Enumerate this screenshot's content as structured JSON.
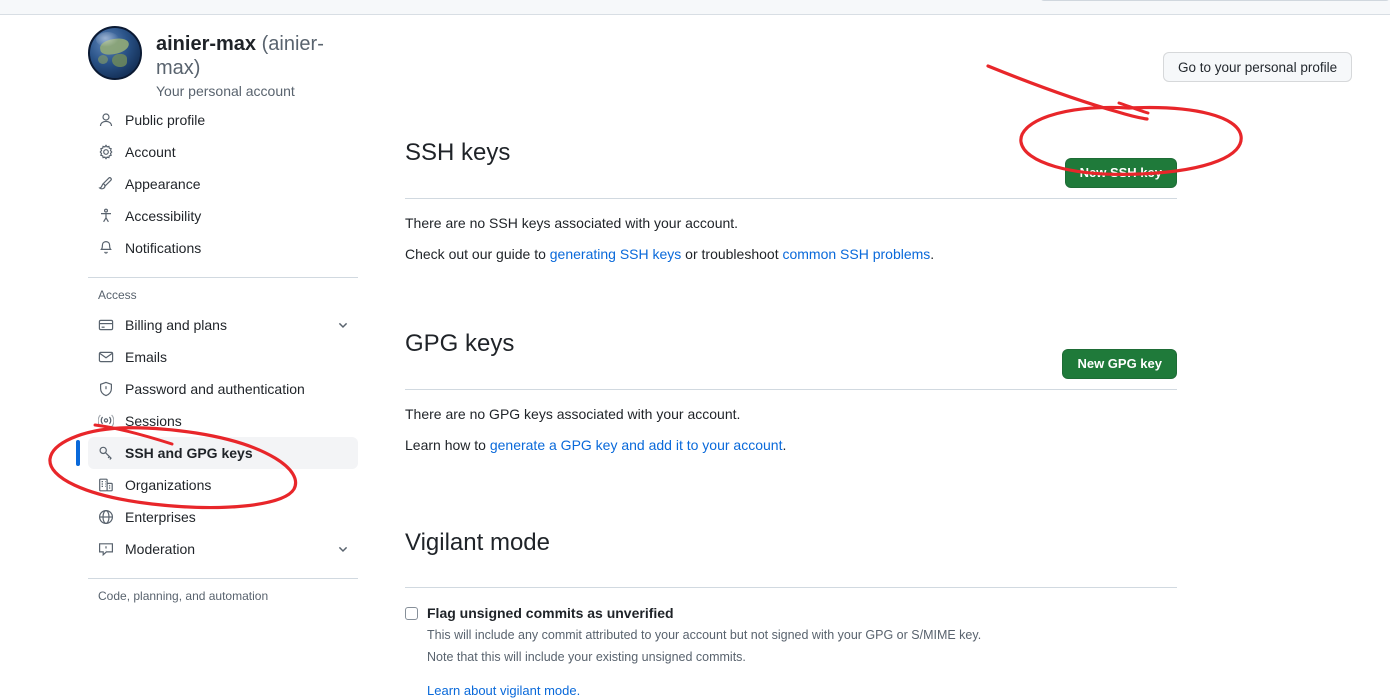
{
  "browser": {
    "address_bar_placeholder": ""
  },
  "profile": {
    "login": "ainier-max",
    "handle": "(ainier-max)",
    "subtitle": "Your personal account",
    "avatar_icon": "globe-avatar",
    "go_to_profile_label": "Go to your personal profile"
  },
  "sidebar": {
    "primary_items": [
      {
        "label": "Public profile",
        "icon": "person-icon",
        "active": false,
        "chevron": false
      },
      {
        "label": "Account",
        "icon": "gear-icon",
        "active": false,
        "chevron": false
      },
      {
        "label": "Appearance",
        "icon": "paintbrush-icon",
        "active": false,
        "chevron": false
      },
      {
        "label": "Accessibility",
        "icon": "accessibility-icon",
        "active": false,
        "chevron": false
      },
      {
        "label": "Notifications",
        "icon": "bell-icon",
        "active": false,
        "chevron": false
      }
    ],
    "access_heading": "Access",
    "access_items": [
      {
        "label": "Billing and plans",
        "icon": "credit-card-icon",
        "active": false,
        "chevron": true
      },
      {
        "label": "Emails",
        "icon": "mail-icon",
        "active": false,
        "chevron": false
      },
      {
        "label": "Password and authentication",
        "icon": "shield-icon",
        "active": false,
        "chevron": false
      },
      {
        "label": "Sessions",
        "icon": "broadcast-icon",
        "active": false,
        "chevron": false
      },
      {
        "label": "SSH and GPG keys",
        "icon": "key-icon",
        "active": true,
        "chevron": false
      },
      {
        "label": "Organizations",
        "icon": "organization-icon",
        "active": false,
        "chevron": false
      },
      {
        "label": "Enterprises",
        "icon": "globe-icon",
        "active": false,
        "chevron": false
      },
      {
        "label": "Moderation",
        "icon": "report-icon",
        "active": false,
        "chevron": true
      }
    ],
    "code_heading": "Code, planning, and automation"
  },
  "ssh_section": {
    "title": "SSH keys",
    "button_label": "New SSH key",
    "empty_text": "There are no SSH keys associated with your account.",
    "guide_prefix": "Check out our guide to ",
    "guide_link": "generating SSH keys",
    "guide_middle": " or troubleshoot ",
    "guide_link2": "common SSH problems",
    "guide_suffix": "."
  },
  "gpg_section": {
    "title": "GPG keys",
    "button_label": "New GPG key",
    "empty_text": "There are no GPG keys associated with your account.",
    "learn_prefix": "Learn how to ",
    "learn_link": "generate a GPG key and add it to your account",
    "learn_suffix": "."
  },
  "vigilant_section": {
    "title": "Vigilant mode",
    "checkbox_label": "Flag unsigned commits as unverified",
    "checkbox_checked": false,
    "note_line1": "This will include any commit attributed to your account but not signed with your GPG or S/MIME key.",
    "note_line2": "Note that this will include your existing unsigned commits.",
    "learn_link": "Learn about vigilant mode."
  },
  "annotations": {
    "color": "#e8262a",
    "marks": [
      {
        "name": "ssh-button-highlight",
        "shape": "ellipse-with-strike"
      },
      {
        "name": "sidebar-ssh-gpg-highlight",
        "shape": "ellipse"
      }
    ]
  },
  "colors": {
    "accent_green": "#1f7a3a",
    "link_blue": "#0969da",
    "active_indicator": "#0969da",
    "annotation_red": "#e8262a",
    "border": "#d1d9e0",
    "muted_text": "#59636e"
  }
}
